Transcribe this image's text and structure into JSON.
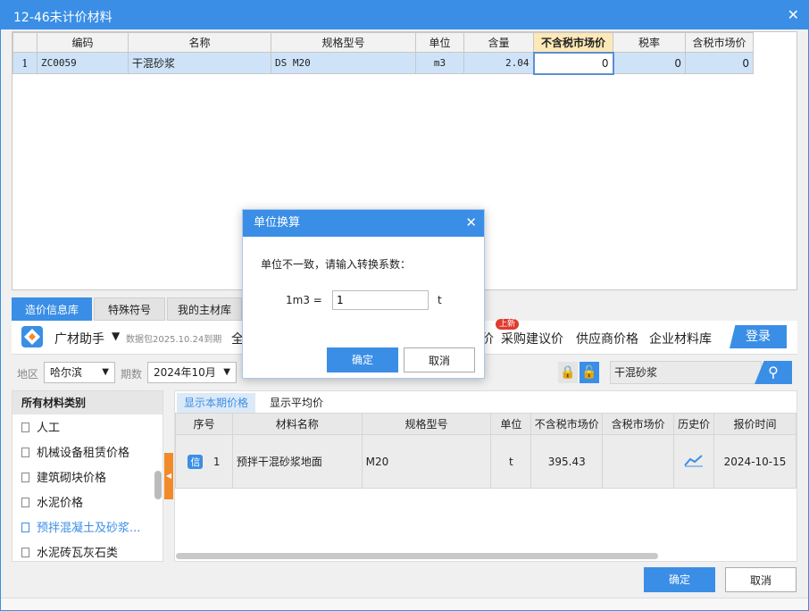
{
  "window": {
    "title": "12-46未计价材料",
    "close_icon": "close-icon"
  },
  "grid": {
    "columns": [
      "编码",
      "名称",
      "规格型号",
      "单位",
      "含量",
      "不含税市场价",
      "税率",
      "含税市场价"
    ],
    "rows": [
      {
        "no": "1",
        "code": "ZC0059",
        "name": "干混砂浆",
        "spec": "DS M20",
        "unit": "m3",
        "qty": "2.04",
        "price_ex": "0",
        "tax": "0",
        "price_in": "0"
      }
    ]
  },
  "lib_tabs": [
    "造价信息库",
    "特殊符号",
    "我的主材库"
  ],
  "toolbar": {
    "brand": "广材助手",
    "package_info": "数据包2025.10.24到期",
    "nav_partial": "全",
    "nav_items": [
      "价",
      "采购建议价",
      "供应商价格",
      "企业材料库"
    ],
    "new_badge": "上新",
    "login": "登录"
  },
  "filter": {
    "region_label": "地区",
    "region": "哈尔滨",
    "period_label": "期数",
    "period": "2024年10月",
    "search_value": "干混砂浆"
  },
  "categories": {
    "header": "所有材料类别",
    "items": [
      "人工",
      "机械设备租赁价格",
      "建筑砌块价格",
      "水泥价格",
      "预拌混凝土及砂浆...",
      "水泥砖瓦灰石类"
    ]
  },
  "price_tabs": [
    "显示本期价格",
    "显示平均价"
  ],
  "price_table": {
    "columns": [
      "序号",
      "材料名称",
      "规格型号",
      "单位",
      "不含税市场价",
      "含税市场价",
      "历史价",
      "报价时间"
    ],
    "rows": [
      {
        "badge": "信",
        "no": "1",
        "name": "预拌干混砂浆地面",
        "spec": "M20",
        "unit": "t",
        "price_ex": "395.43",
        "price_in": "",
        "date": "2024-10-15"
      }
    ]
  },
  "footer": {
    "ok": "确定",
    "cancel": "取消"
  },
  "dialog": {
    "title": "单位换算",
    "message": "单位不一致，请输入转换系数：",
    "from_label": "1m3 =",
    "value": "1",
    "to_unit": "t",
    "ok": "确定",
    "cancel": "取消"
  },
  "colors": {
    "accent": "#3a8ee6",
    "badge": "#e03b2f",
    "splitter": "#f28a2a"
  }
}
